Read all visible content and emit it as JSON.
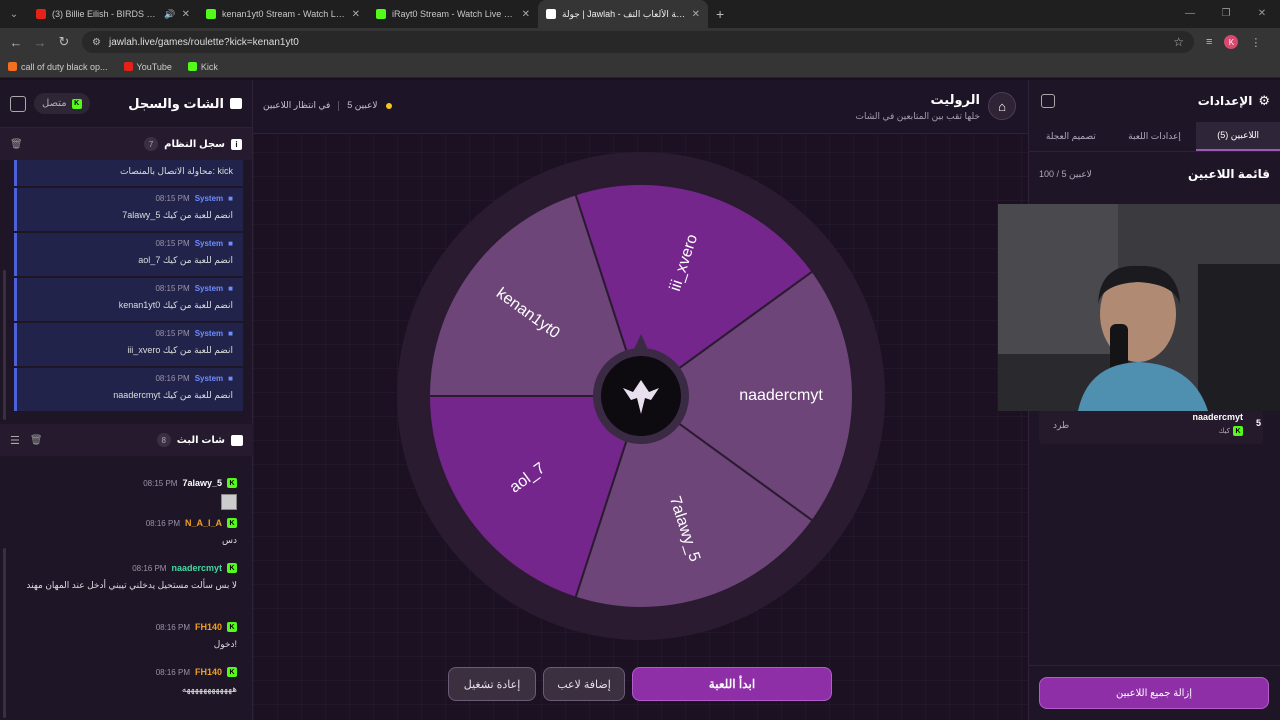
{
  "browser": {
    "tabs": [
      {
        "title": "(3) Billie Eilish - BIRDS OF A",
        "fav_color": "#e62117",
        "active": false
      },
      {
        "title": "kenan1yt0 Stream - Watch Live",
        "fav_color": "#53fc18",
        "active": false
      },
      {
        "title": "iRayt0 Stream - Watch Live on K",
        "fav_color": "#53fc18",
        "active": false
      },
      {
        "title": "جولة | Jawlah - منصة الألعاب التف",
        "fav_color": "#ffffff",
        "active": true
      }
    ],
    "url": "jawlah.live/games/roulette?kick=kenan1yt0",
    "profile_initial": "K",
    "bookmarks": [
      {
        "label": "call of duty black op...",
        "color": "#f37021"
      },
      {
        "label": "YouTube",
        "color": "#e62117"
      },
      {
        "label": "Kick",
        "color": "#53fc18"
      }
    ]
  },
  "left_panel": {
    "title": "الشات والسجل",
    "connection": "متصل",
    "system_log": {
      "title": "سجل النظام",
      "count": "7",
      "first_message": "محاولة الاتصال بالمنصات: kick",
      "entries": [
        {
          "author": "System",
          "time": "08:15 PM",
          "text": "7alawy_5 انضم للعبة من كيك"
        },
        {
          "author": "System",
          "time": "08:15 PM",
          "text": "aol_7 انضم للعبة من كيك"
        },
        {
          "author": "System",
          "time": "08:15 PM",
          "text": "kenan1yt0 انضم للعبة من كيك"
        },
        {
          "author": "System",
          "time": "08:15 PM",
          "text": "iii_xvero انضم للعبة من كيك"
        },
        {
          "author": "System",
          "time": "08:16 PM",
          "text": "naadercmyt انضم للعبة من كيك"
        }
      ]
    },
    "live_chat": {
      "title": "شات البث",
      "count": "8",
      "messages": [
        {
          "user": "7alawy_5",
          "color": "#ffffff",
          "time": "08:15 PM",
          "text": ""
        },
        {
          "user": "N_A_I_A",
          "color": "#f0a020",
          "time": "08:16 PM",
          "text": "دس"
        },
        {
          "user": "naadercmyt",
          "color": "#46d8a3",
          "time": "08:16 PM",
          "text": "لا بس سألت مستحيل يدخلني تيبني أدخل عند المهان مهند"
        },
        {
          "user": "FH140",
          "color": "#f0a020",
          "time": "08:16 PM",
          "text": "دخول!"
        },
        {
          "user": "FH140",
          "color": "#f0a020",
          "time": "08:16 PM",
          "text": "ههههههههههههه"
        }
      ]
    }
  },
  "center": {
    "title": "الروليت",
    "subtitle": "خلها تقب بين المتابعين في الشات",
    "status_players": "5 لاعبين",
    "status_waiting": "في انتظار اللاعبين",
    "wheel": {
      "segments": [
        {
          "name": "iii_xvero",
          "color": "#74268c"
        },
        {
          "name": "naadercmyt",
          "color": "#6d4578"
        },
        {
          "name": "7alawy_5",
          "color": "#6d4578"
        },
        {
          "name": "aol_7",
          "color": "#74268c"
        },
        {
          "name": "kenan1yt0",
          "color": "#6d4578"
        }
      ]
    },
    "buttons": {
      "restart": "إعادة تشغيل",
      "add_player": "إضافة لاعب",
      "start": "ابدأ اللعبة"
    }
  },
  "right_panel": {
    "title": "الإعدادات",
    "tabs": [
      "اللاعبين (5)",
      "إعدادات اللعبة",
      "تصميم العجلة"
    ],
    "players_title": "قائمة اللاعبين",
    "players_count": "100 / 5 لاعبين",
    "visible_player": {
      "index": "5",
      "name": "naadercmyt",
      "platform": "كيك",
      "action": "طرد"
    },
    "clear_all": "إزالة جميع اللاعبين"
  },
  "colors": {
    "accent": "#8e2fa8",
    "kick": "#53fc18",
    "system": "#6e8dff"
  }
}
